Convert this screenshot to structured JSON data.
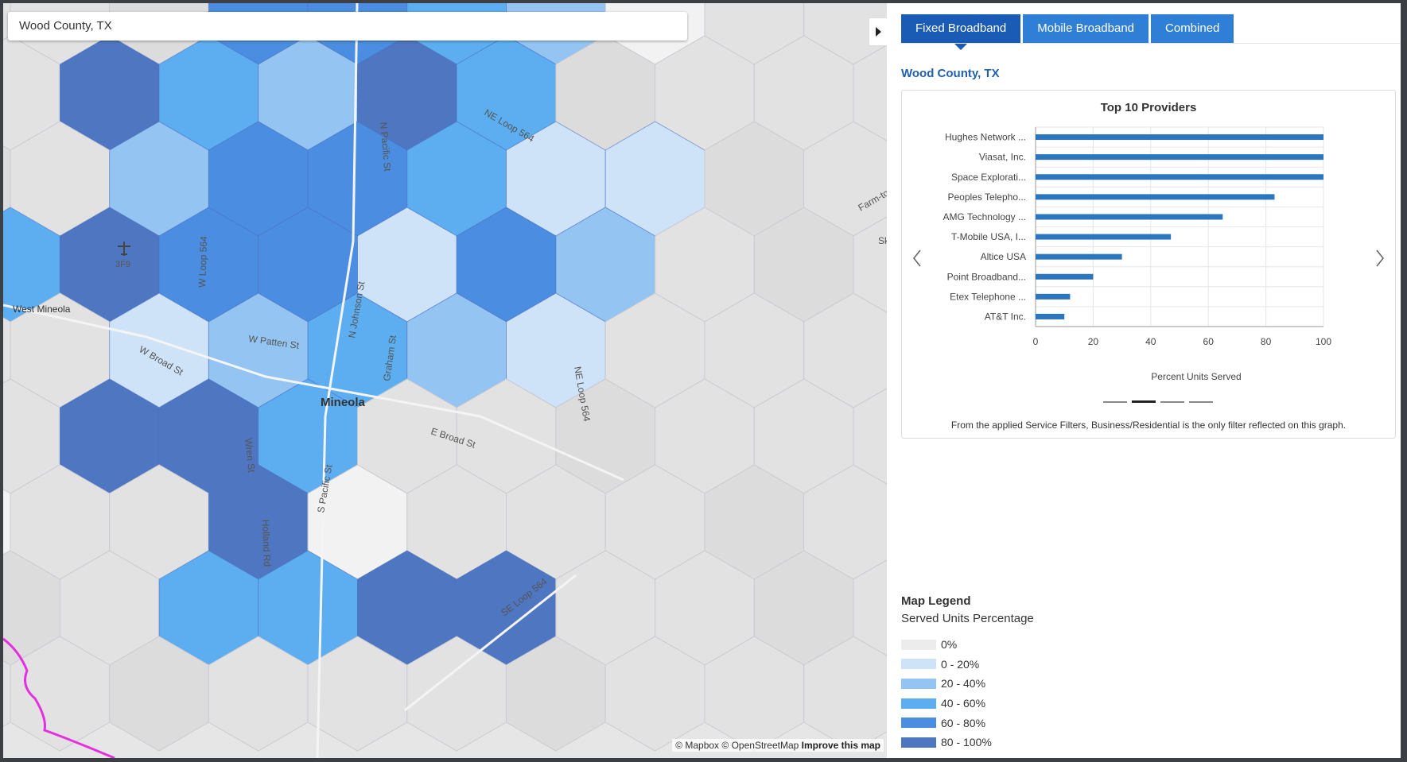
{
  "search": {
    "value": "Wood County, TX"
  },
  "tabs": [
    {
      "label": "Fixed Broadband",
      "active": true
    },
    {
      "label": "Mobile Broadband",
      "active": false
    },
    {
      "label": "Combined",
      "active": false
    }
  ],
  "region_title": "Wood County, TX",
  "map_labels": {
    "places": [
      "Mineola",
      "West Mineola",
      "3F9"
    ],
    "streets": [
      "N Pacific St",
      "NE Loop 564",
      "W Loop 564",
      "N Johnson St",
      "W Patten St",
      "W Broad St",
      "Graham St",
      "NE Loop 564",
      "E Broad St",
      "Wren St",
      "S Pacific St",
      "Holland Rd",
      "SE Loop 564",
      "Farm-to",
      "Sk"
    ]
  },
  "attribution": {
    "mapbox": "© Mapbox",
    "osm": "© OpenStreetMap",
    "improve": "Improve this map"
  },
  "hex_colors": [
    "#ececec",
    "#cfe3f8",
    "#94c5f2",
    "#5daef0",
    "#4b8de0",
    "#4f76c0"
  ],
  "chart_data": {
    "type": "bar",
    "orientation": "horizontal",
    "title": "Top 10 Providers",
    "categories": [
      "Hughes Network ...",
      "Viasat, Inc.",
      "Space Explorati...",
      "Peoples Telepho...",
      "AMG Technology ...",
      "T-Mobile USA, I...",
      "Altice USA",
      "Point Broadband...",
      "Etex Telephone ...",
      "AT&T Inc."
    ],
    "values": [
      100,
      100,
      100,
      83,
      65,
      47,
      30,
      20,
      12,
      10
    ],
    "xlabel": "Percent Units Served",
    "ylabel": "",
    "xlim": [
      0,
      100
    ],
    "xticks": [
      0,
      20,
      40,
      60,
      80,
      100
    ],
    "grid": true,
    "bar_color": "#2b76be",
    "pager": {
      "pages": 4,
      "active": 1
    },
    "note": "From the applied Service Filters, Business/Residential is the only filter reflected on this graph."
  },
  "legend": {
    "title": "Map Legend",
    "subtitle": "Served Units Percentage",
    "items": [
      {
        "label": "0%",
        "color": "#ececec"
      },
      {
        "label": "0 - 20%",
        "color": "#cfe3f8"
      },
      {
        "label": "20 - 40%",
        "color": "#94c5f2"
      },
      {
        "label": "40 - 60%",
        "color": "#5daef0"
      },
      {
        "label": "60 - 80%",
        "color": "#4b8de0"
      },
      {
        "label": "80 - 100%",
        "color": "#4f76c0"
      }
    ]
  }
}
